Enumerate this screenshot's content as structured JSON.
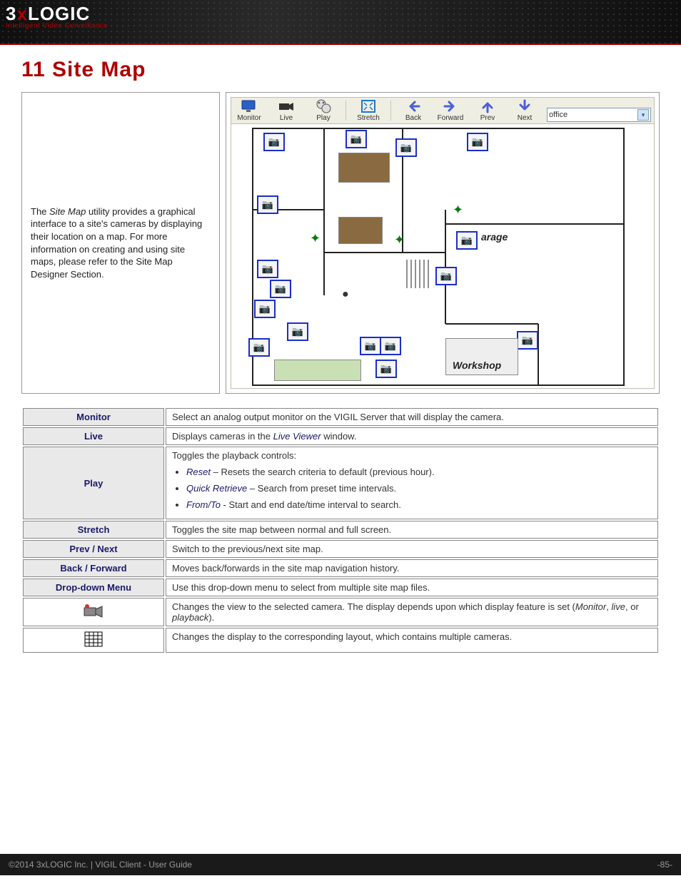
{
  "logo": {
    "brand_html_plain": "3xLOGIC",
    "tagline": "Intelligent Video Surveillance"
  },
  "section_title": "11 Site Map",
  "intro_text": "The Site Map utility provides a graphical interface to a site's cameras by displaying their location on a map. For more information on creating and using site maps, please refer to the Site Map Designer Section.",
  "intro_highlight": "Site Map",
  "toolbar": {
    "monitor": "Monitor",
    "live": "Live",
    "play": "Play",
    "stretch": "Stretch",
    "back": "Back",
    "forward": "Forward",
    "prev": "Prev",
    "next": "Next",
    "dropdown_value": "office"
  },
  "map_labels": {
    "garage": "arage",
    "workshop": "Workshop"
  },
  "table": {
    "monitor": {
      "label": "Monitor",
      "desc": "Select an analog output monitor on the VIGIL Server that will display the camera."
    },
    "live": {
      "label": "Live",
      "desc_pre": "Displays cameras in the ",
      "desc_em": "Live Viewer",
      "desc_post": " window."
    },
    "play": {
      "label": "Play",
      "lead": "Toggles the playback controls:",
      "items": [
        {
          "term": "Reset",
          "dash": " – ",
          "desc": "Resets the search criteria to default (previous hour)."
        },
        {
          "term": "Quick Retrieve",
          "dash": " – ",
          "desc": "Search from preset time intervals."
        },
        {
          "term": "From/To",
          "dash": " - ",
          "desc": "Start and end date/time interval to search."
        }
      ]
    },
    "stretch": {
      "label": "Stretch",
      "desc": "Toggles the site map between normal and full screen."
    },
    "prevnext": {
      "label": "Prev / Next",
      "desc": "Switch to the previous/next site map."
    },
    "backfwd": {
      "label": "Back / Forward",
      "desc": "Moves back/forwards in the site map navigation history."
    },
    "dropdown": {
      "label": "Drop-down Menu",
      "desc": "Use this drop-down menu to select from multiple site map files."
    },
    "cam_icon": {
      "desc_pre": "Changes the view to the selected camera. The display depends upon which display feature is set (",
      "desc_em1": "Monitor",
      "desc_mid1": ", ",
      "desc_em2": "live",
      "desc_mid2": ", or ",
      "desc_em3": "playback",
      "desc_post": ")."
    },
    "grid_icon": {
      "desc": "Changes the display to the corresponding layout, which contains multiple cameras."
    }
  },
  "footer": {
    "left": "©2014 3xLOGIC Inc.  |  VIGIL Client - User Guide",
    "right": "-85-"
  }
}
